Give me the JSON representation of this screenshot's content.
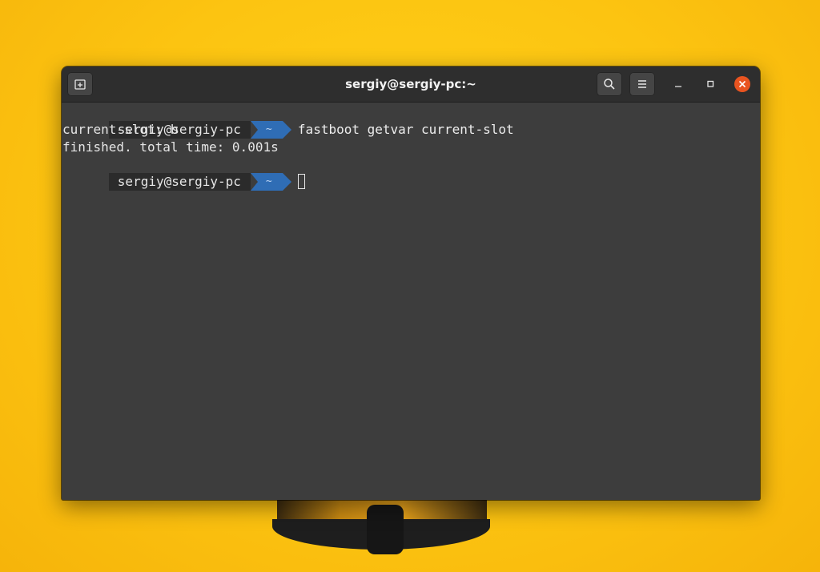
{
  "window": {
    "title": "sergiy@sergiy-pc:~"
  },
  "icons": {
    "new_tab": "new-tab-icon",
    "search": "search-icon",
    "menu": "hamburger-menu-icon",
    "minimize": "minimize-icon",
    "maximize": "maximize-icon",
    "close": "close-icon"
  },
  "colors": {
    "close_button": "#e95420",
    "prompt_dir_bg": "#2f6db5",
    "terminal_bg": "#3d3d3d",
    "desktop_bg": "#fcc411"
  },
  "terminal": {
    "prompt1": {
      "host": "sergiy@sergiy-pc",
      "dir": "~",
      "command": "fastboot getvar current-slot"
    },
    "output": [
      "current-slot: b",
      "finished. total time: 0.001s"
    ],
    "prompt2": {
      "host": "sergiy@sergiy-pc",
      "dir": "~",
      "command": ""
    }
  }
}
